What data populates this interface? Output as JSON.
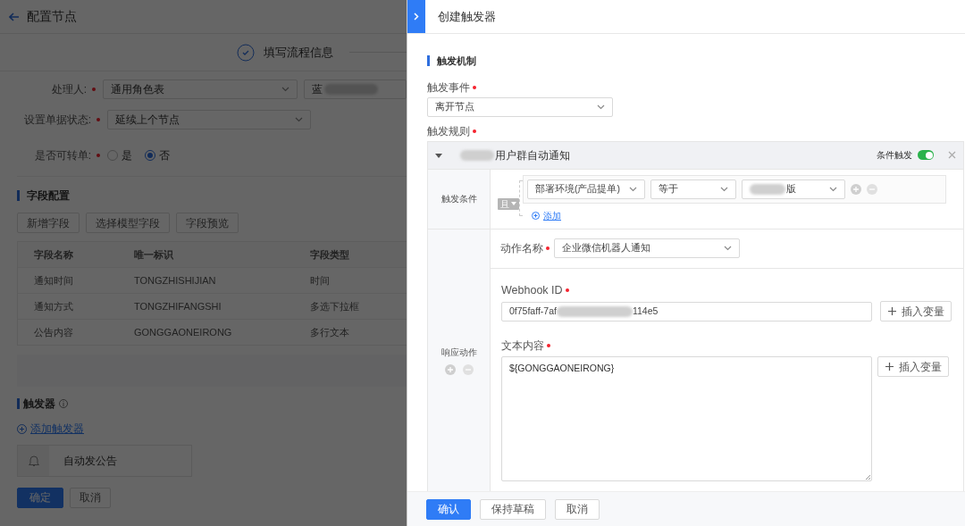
{
  "page": {
    "title": "配置节点",
    "step": {
      "label": "填写流程信息",
      "completed": true
    },
    "form": [
      {
        "kind": "select",
        "label": "处理人:",
        "required": true,
        "value": "通用角色表",
        "extra_value": "蓝",
        "extra_redacted": true
      },
      {
        "kind": "select",
        "label": "设置单据状态:",
        "required": true,
        "value": "延续上个节点"
      },
      {
        "kind": "radio",
        "label": "是否可转单:",
        "required": true,
        "options": [
          {
            "label": "是",
            "selected": false
          },
          {
            "label": "否",
            "selected": true
          }
        ]
      }
    ],
    "fields_section": {
      "title": "字段配置",
      "buttons": [
        "新增字段",
        "选择模型字段",
        "字段预览"
      ],
      "table": {
        "columns": [
          "字段名称",
          "唯一标识",
          "字段类型"
        ],
        "rows": [
          [
            "通知时间",
            "TONGZHISHIJIAN",
            "时间"
          ],
          [
            "通知方式",
            "TONGZHIFANGSHI",
            "多选下拉框"
          ],
          [
            "公告内容",
            "GONGGAONEIRONG",
            "多行文本"
          ]
        ]
      }
    },
    "triggers_section": {
      "title": "触发器",
      "add_link": "添加触发器",
      "items": [
        {
          "name": "自动发公告"
        }
      ]
    },
    "buttons": [
      {
        "label": "确定",
        "primary": true
      },
      {
        "label": "取消",
        "primary": false
      }
    ]
  },
  "drawer": {
    "title": "创建触发器",
    "section_title": "触发机制",
    "event": {
      "label": "触发事件",
      "required": true,
      "value": "离开节点"
    },
    "rules_label": {
      "label": "触发规则",
      "required": true
    },
    "rule": {
      "name": "用户群自动通知",
      "name_redacted": true,
      "expanded": true,
      "toggle_label": "条件触发",
      "condition_trigger": true,
      "conditions_label": "触发条件",
      "logic": "且",
      "conditions": [
        {
          "field": "部署环境(产品提单)",
          "operator": "等于",
          "value": "版",
          "value_redacted": true
        }
      ],
      "add_condition": "添加",
      "actions_label": "响应动作",
      "action": {
        "label": "动作名称",
        "required": true,
        "value": "企业微信机器人通知",
        "webhook": {
          "label": "Webhook ID",
          "required": true,
          "value_start": "0f75faff-7af",
          "value_end": "114e5",
          "button": "插入变量"
        },
        "content": {
          "label": "文本内容",
          "required": true,
          "value": "${GONGGAONEIRONG}",
          "button": "插入变量"
        }
      }
    },
    "buttons": [
      {
        "label": "确认",
        "primary": true
      },
      {
        "label": "保持草稿",
        "primary": false
      },
      {
        "label": "取消",
        "primary": false
      }
    ]
  }
}
